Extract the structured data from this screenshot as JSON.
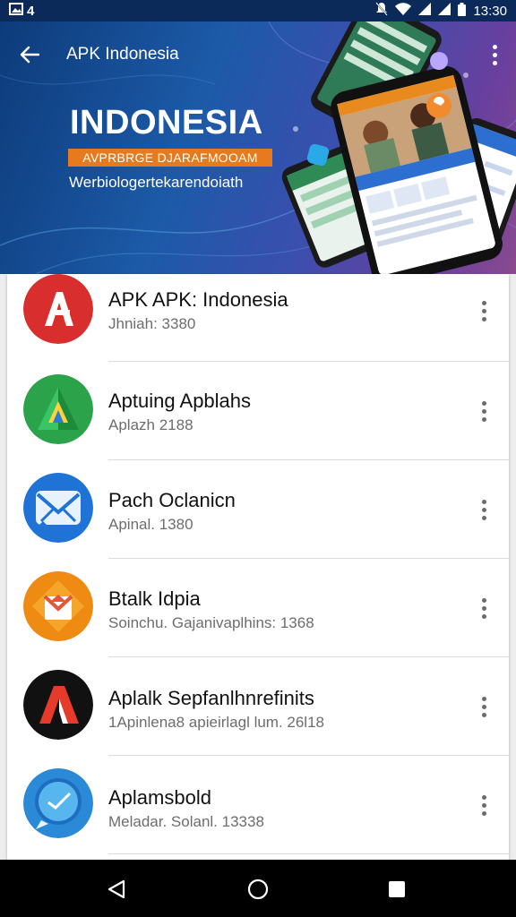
{
  "status_bar": {
    "left_text": "4",
    "time": "13:30",
    "icons": [
      "gallery-icon",
      "mute-icon",
      "wifi-icon",
      "signal-icon",
      "signal-icon",
      "battery-icon"
    ]
  },
  "header": {
    "title": "APK Indonesia",
    "back_icon": "arrow-left-icon",
    "menu_icon": "overflow-menu-icon",
    "hero_heading": "INDONESIA",
    "hero_tagline": "AVPRBRGE DJARAFMOOAM",
    "hero_subtitle": "Werbiologertekarendoiath",
    "colors": {
      "accent": "#e87a1e",
      "hero_start": "#0d3b7a",
      "hero_end": "#8a4a8f"
    }
  },
  "apps": [
    {
      "name": "APK APK: Indonesia",
      "meta": "Jhniah: 3380",
      "icon": "red-a-icon",
      "color": "#d92e2e"
    },
    {
      "name": "Aptuing Apblahs",
      "meta": "Aplazh 2188",
      "icon": "green-a-icon",
      "color": "#2aa34a"
    },
    {
      "name": "Pach Oclanicn",
      "meta": "Apinal. 1380",
      "icon": "mail-icon",
      "color": "#1f72d6"
    },
    {
      "name": "Btalk Idpia",
      "meta": "Soinchu. Gajanivaplhins: 1368",
      "icon": "orange-box-icon",
      "color": "#ef8a12"
    },
    {
      "name": "Aplalk Sepfanlhnrefinits",
      "meta": "1Apinlena8 apieirlagl lum. 26l18",
      "icon": "black-a-icon",
      "color": "#111111"
    },
    {
      "name": "Aplamsbold",
      "meta": "Meladar. Solanl. 13338",
      "icon": "blue-chat-icon",
      "color": "#2a8ad8"
    }
  ],
  "nav": {
    "back_icon": "nav-back-icon",
    "home_icon": "nav-home-icon",
    "recents_icon": "nav-recents-icon"
  }
}
